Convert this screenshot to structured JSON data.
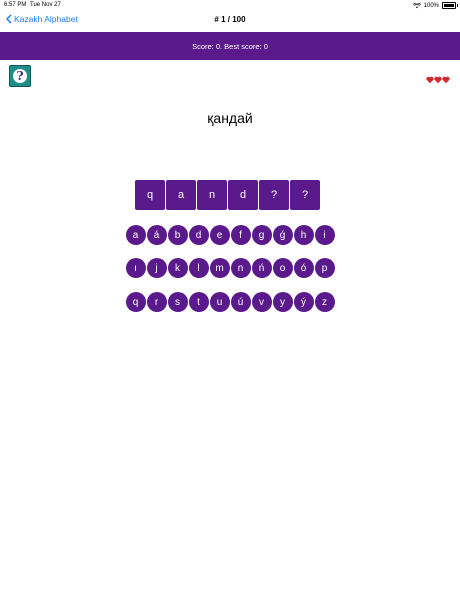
{
  "status_bar": {
    "time": "6:57 PM",
    "date": "Tue Nov 27",
    "battery": "100%"
  },
  "navbar": {
    "back_label": "Kazakh Alphabet",
    "title": "# 1 / 100"
  },
  "score_text": "Score: 0. Best score: 0",
  "help_icon_glyph": "?",
  "lives_count": 3,
  "colors": {
    "accent": "#5a1a8c",
    "link": "#1a7cf0",
    "heart": "#d0282e",
    "help_bg": "#1d8f8a"
  },
  "word": "қандай",
  "answer_slots": [
    "q",
    "a",
    "n",
    "d",
    "?",
    "?"
  ],
  "keyboard": {
    "row1": [
      "a",
      "á",
      "b",
      "d",
      "e",
      "f",
      "g",
      "ǵ",
      "h",
      "i"
    ],
    "row2": [
      "ı",
      "j",
      "k",
      "l",
      "m",
      "n",
      "ń",
      "o",
      "ó",
      "p"
    ],
    "row3": [
      "q",
      "r",
      "s",
      "t",
      "u",
      "ú",
      "v",
      "y",
      "ý",
      "z"
    ]
  }
}
